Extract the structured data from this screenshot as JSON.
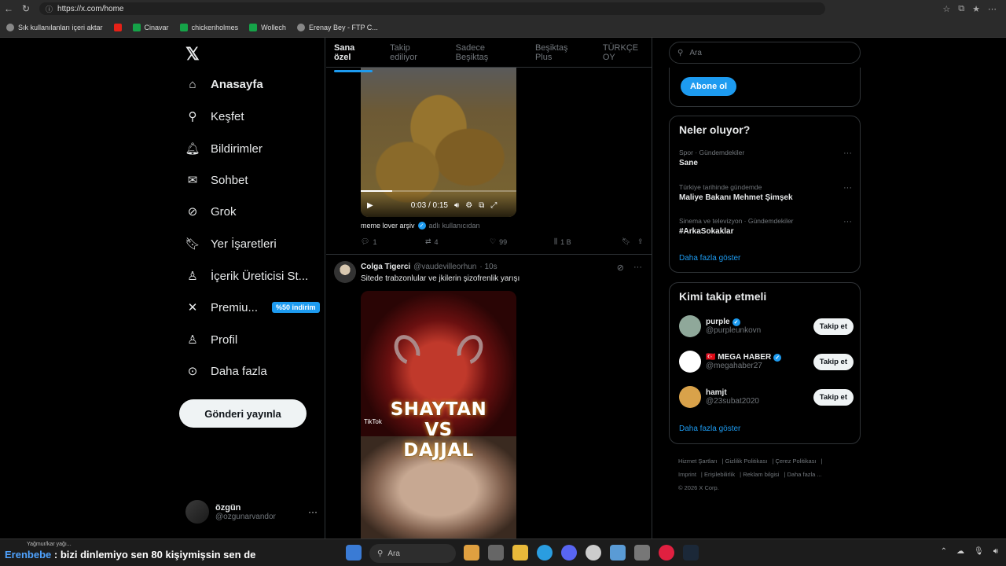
{
  "browser": {
    "url": "https://x.com/home",
    "bookmarks": [
      "Sık kullanılanları içeri aktar",
      "Cinavar",
      "chickenholmes",
      "Wollech",
      "Erenay Bey - FTP C..."
    ]
  },
  "nav": {
    "items": [
      {
        "label": "Anasayfa",
        "icon": "home-icon"
      },
      {
        "label": "Keşfet",
        "icon": "search-icon"
      },
      {
        "label": "Bildirimler",
        "icon": "bell-icon"
      },
      {
        "label": "Sohbet",
        "icon": "mail-icon"
      },
      {
        "label": "Grok",
        "icon": "grok-icon"
      },
      {
        "label": "Yer İşaretleri",
        "icon": "bookmark-icon"
      },
      {
        "label": "İçerik Üreticisi St...",
        "icon": "creator-icon"
      },
      {
        "label": "Premiu...",
        "icon": "x-icon",
        "badge": "%50 indirim"
      },
      {
        "label": "Profil",
        "icon": "person-icon"
      },
      {
        "label": "Daha fazla",
        "icon": "more-icon"
      }
    ],
    "post_button": "Gönderi yayınla",
    "account": {
      "name": "özgün",
      "handle": "@ozgunarvandor"
    }
  },
  "tabs": [
    "Sana özel",
    "Takip ediliyor",
    "Sadece Beşiktaş",
    "Beşiktaş Plus",
    "TÜRKÇE OY"
  ],
  "tweet1": {
    "video_time": "0:03 / 0:15",
    "video_progress": 0.2,
    "source_name": "meme lover arşiv",
    "source_suffix": "adlı kullanıcıdan",
    "replies": "1",
    "reposts": "4",
    "likes": "99",
    "views": "1 B"
  },
  "tweet2": {
    "name": "Colga Tigerci",
    "handle": "@vaudevilleorhun",
    "time": "· 10s",
    "text": "Sitede trabzonlular ve jkilerin şizofrenlik yarışı",
    "overlay_line1": "SHAYTAN",
    "overlay_line2": "VS",
    "overlay_line3": "DAJJAL",
    "tiktok": "TikTok"
  },
  "right": {
    "search_placeholder": "Ara",
    "subscribe": "Abone ol",
    "trends_title": "Neler oluyor?",
    "trends": [
      {
        "category": "Spor · Gündemdekiler",
        "title": "Sane"
      },
      {
        "category": "Türkiye tarihinde gündemde",
        "title": "Maliye Bakanı Mehmet Şimşek"
      },
      {
        "category": "Sinema ve televizyon · Gündemdekiler",
        "title": "#ArkaSokaklar"
      }
    ],
    "show_more": "Daha fazla göster",
    "follow_title": "Kimi takip etmeli",
    "follow": [
      {
        "name": "purple",
        "handle": "@purpleunkovn",
        "verified": true,
        "color": "#8fa89a"
      },
      {
        "name": "🇹🇷 MEGA HABER",
        "handle": "@megahaber27",
        "verified": true,
        "color": "#ffffff"
      },
      {
        "name": "hamjt",
        "handle": "@23subat2020",
        "verified": false,
        "color": "#d9a24a"
      }
    ],
    "follow_button": "Takip et",
    "footer": [
      "Hizmet Şartları",
      "Gizlilik Politikası",
      "Çerez Politikası",
      "Imprint",
      "Erişilebilirlik",
      "Reklam bilgisi",
      "Daha fazla ...",
      "© 2026 X Corp."
    ]
  },
  "taskbar": {
    "weather": "Yağmur/kar yağı...",
    "chat_user": "Erenbebe",
    "chat_text": ": bizi dinlemiyo sen 80 kişiymişsin sen de",
    "search": "Ara"
  },
  "colors": {
    "accent": "#1d9bf0",
    "bg": "#000000",
    "border": "#2f3336"
  }
}
